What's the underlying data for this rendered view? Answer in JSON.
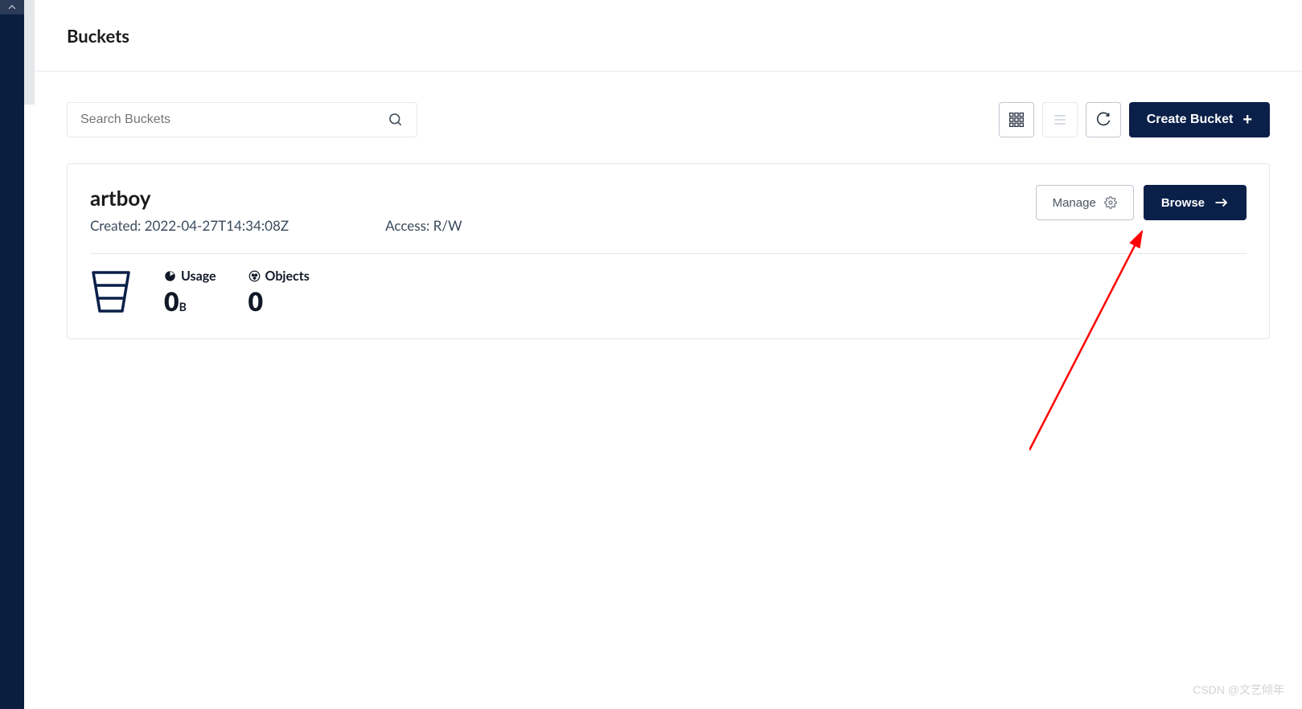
{
  "header": {
    "title": "Buckets"
  },
  "search": {
    "placeholder": "Search Buckets"
  },
  "toolbar": {
    "create_label": "Create Bucket"
  },
  "bucket": {
    "name": "artboy",
    "created_label": "Created:",
    "created_value": "2022-04-27T14:34:08Z",
    "access_label": "Access:",
    "access_value": "R/W",
    "manage_label": "Manage",
    "browse_label": "Browse",
    "stats": {
      "usage_label": "Usage",
      "usage_value": "0",
      "usage_unit": "B",
      "objects_label": "Objects",
      "objects_value": "0"
    }
  },
  "watermark": "CSDN @文艺倾年"
}
